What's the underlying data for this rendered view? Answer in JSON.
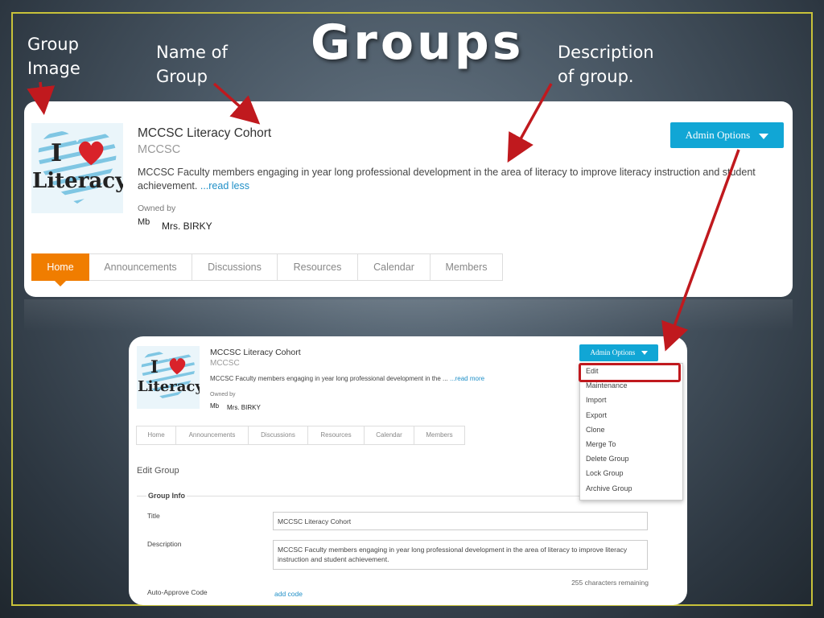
{
  "slide": {
    "title": "Groups",
    "callouts": {
      "group_image": [
        "Group",
        "Image"
      ],
      "name_of_group": [
        "Name of",
        "Group"
      ],
      "description": [
        "Description",
        "of group."
      ]
    }
  },
  "group": {
    "logo_line1": "I",
    "logo_line2": "Literacy",
    "name": "MCCSC Literacy Cohort",
    "subtitle": "MCCSC",
    "description_full": "MCCSC Faculty members engaging in year long professional development in the area of literacy to improve literacy instruction and student",
    "description_cont": "achievement.",
    "read_less": "...read less",
    "description_short": "MCCSC Faculty members engaging in year long professional development in the ...",
    "read_more": "...read more",
    "owned_by_label": "Owned by",
    "owner_initials": "Mb",
    "owner_name": "Mrs. BIRKY"
  },
  "admin_button": {
    "label": "Admin Options"
  },
  "tabs": [
    "Home",
    "Announcements",
    "Discussions",
    "Resources",
    "Calendar",
    "Members"
  ],
  "admin_menu": [
    "Edit",
    "Maintenance",
    "Import",
    "Export",
    "Clone",
    "Merge To",
    "Delete Group",
    "Lock Group",
    "Archive Group"
  ],
  "edit_form": {
    "heading": "Edit Group",
    "section": "Group Info",
    "title_label": "Title",
    "title_value": "MCCSC Literacy Cohort",
    "description_label": "Description",
    "description_value": "MCCSC Faculty members engaging in year long professional development in the area of literacy to improve literacy instruction and student achievement.",
    "chars_remaining": "255 characters remaining",
    "auto_approve_label": "Auto-Approve Code",
    "add_code": "add code"
  },
  "colors": {
    "accent_orange": "#f07d00",
    "button_blue": "#11a6d5",
    "annotation_red": "#c0191e",
    "frame_yellow": "#c8c23a",
    "link_blue": "#1f8fc7"
  }
}
